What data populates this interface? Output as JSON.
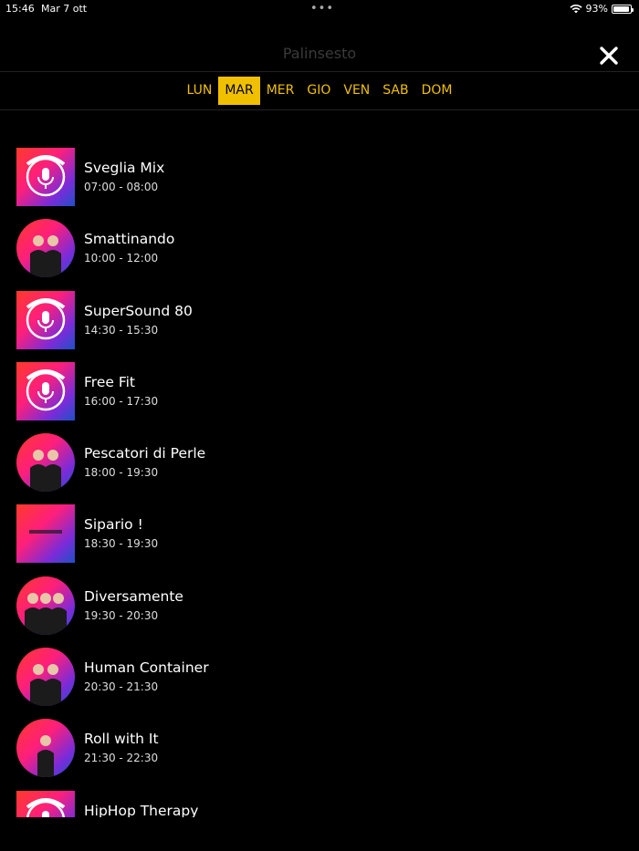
{
  "status_bar": {
    "time": "15:46",
    "date": "Mar 7 ott",
    "battery": "93%",
    "battery_level": 0.93
  },
  "header": {
    "title": "Palinsesto"
  },
  "days": [
    {
      "label": "LUN",
      "active": false
    },
    {
      "label": "MAR",
      "active": true
    },
    {
      "label": "MER",
      "active": false
    },
    {
      "label": "GIO",
      "active": false
    },
    {
      "label": "VEN",
      "active": false
    },
    {
      "label": "SAB",
      "active": false
    },
    {
      "label": "DOM",
      "active": false
    }
  ],
  "schedule": [
    {
      "name": "Sveglia Mix",
      "time": "07:00 - 08:00",
      "thumb": "logo"
    },
    {
      "name": "Smattinando",
      "time": "10:00 - 12:00",
      "thumb": "people-2"
    },
    {
      "name": "SuperSound 80",
      "time": "14:30 - 15:30",
      "thumb": "logo"
    },
    {
      "name": "Free Fit",
      "time": "16:00 - 17:30",
      "thumb": "logo"
    },
    {
      "name": "Pescatori di Perle",
      "time": "18:00 - 19:30",
      "thumb": "people-2"
    },
    {
      "name": "Sipario !",
      "time": "18:30 - 19:30",
      "thumb": "poster"
    },
    {
      "name": "Diversamente",
      "time": "19:30 - 20:30",
      "thumb": "people-3"
    },
    {
      "name": "Human Container",
      "time": "20:30 - 21:30",
      "thumb": "people-2"
    },
    {
      "name": "Roll with It",
      "time": "21:30 - 22:30",
      "thumb": "people-1"
    },
    {
      "name": "HipHop Therapy",
      "time": "",
      "thumb": "logo"
    }
  ],
  "icons": {
    "close": "close-icon",
    "wifi": "wifi-icon",
    "battery": "battery-icon"
  }
}
